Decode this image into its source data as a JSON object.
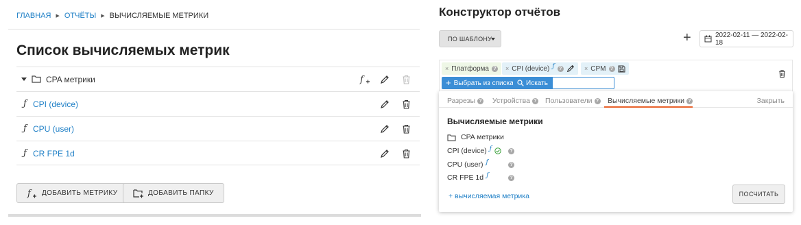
{
  "breadcrumb": {
    "home": "ГЛАВНАЯ",
    "reports": "ОТЧЁТЫ",
    "current": "ВЫЧИСЛЯЕМЫЕ МЕТРИКИ",
    "sep": "▶"
  },
  "left": {
    "title": "Список вычисляемых метрик",
    "folder_label": "CPA метрики",
    "fx_glyph": "ƒ",
    "metrics": [
      "CPI (device)",
      "CPU (user)",
      "CR FPE 1d"
    ],
    "add_metric_label": "ДОБАВИТЬ МЕТРИКУ",
    "add_folder_label": "ДОБАВИТЬ ПАПКУ"
  },
  "right": {
    "title": "Конструктор отчётов",
    "template_label": "ПО ШАБЛОНУ",
    "plus": "+",
    "date_range": "2022-02-11 — 2022-02-18",
    "chips": {
      "platform": "Платформа",
      "cpi": "CPI (device)",
      "cpm": "CPM",
      "x": "×",
      "q": "?"
    },
    "select_from_list": "Выбрать из списка",
    "search_label": "Искать",
    "tabs": [
      "Разрезы",
      "Устройства",
      "Пользователи",
      "Вычисляемые метрики"
    ],
    "close_label": "Закрыть",
    "popup_title": "Вычисляемые метрики",
    "popup_folder": "CPA метрики",
    "popup_metrics": [
      "CPI (device)",
      "CPU (user)",
      "CR FPE 1d"
    ],
    "add_calc_metric": "+ вычисляемая метрика",
    "calc_button": "ПОСЧИТАТЬ"
  },
  "colors": {
    "link": "#1e7fc6",
    "accent_blue": "#3b8ed6",
    "tab_underline": "#e8622c",
    "chip_green": "#eef7e6",
    "chip_blue": "#e3f1f8"
  }
}
